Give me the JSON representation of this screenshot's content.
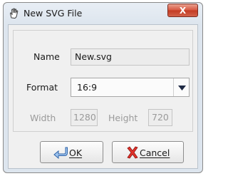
{
  "window": {
    "title": "New SVG File",
    "close_label": "X"
  },
  "form": {
    "name_label": "Name",
    "name_value": "New.svg",
    "format_label": "Format",
    "format_value": "16:9",
    "width_label": "Width",
    "width_value": "1280",
    "height_label": "Height",
    "height_value": "720"
  },
  "buttons": {
    "ok_label": "OK",
    "cancel_label": "Cancel"
  },
  "icons": {
    "app": "hand-icon",
    "ok": "enter-arrow-icon",
    "cancel": "red-x-icon",
    "dropdown": "triangle-down-icon"
  }
}
